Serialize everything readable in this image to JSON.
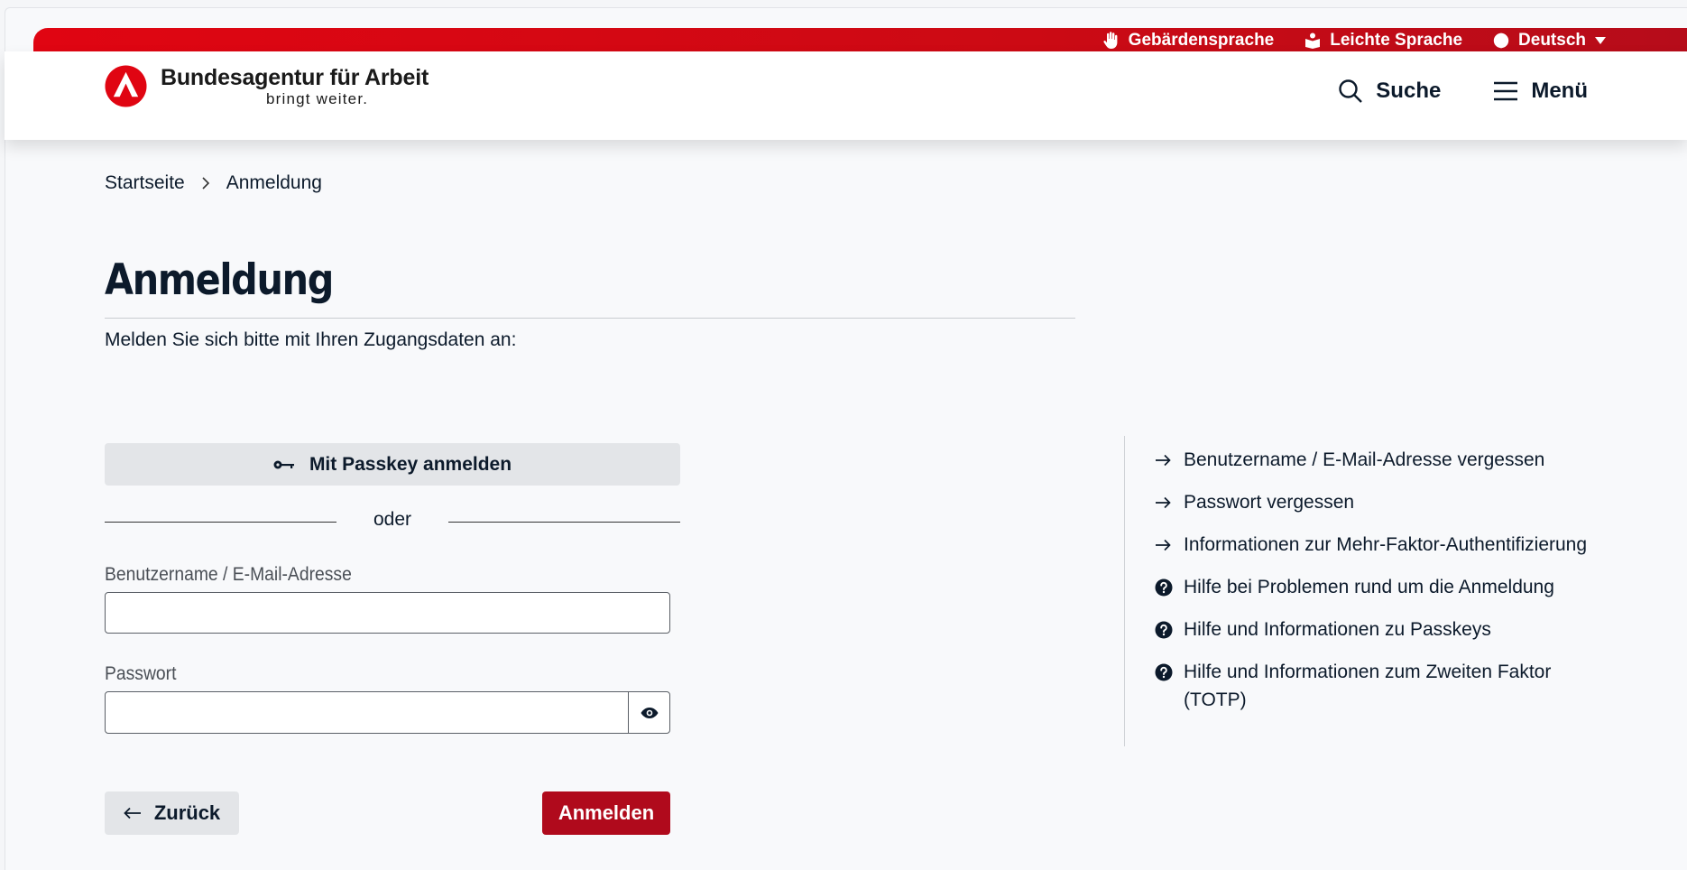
{
  "topbar": {
    "sign_language": "Gebärdensprache",
    "easy_language": "Leichte Sprache",
    "language": "Deutsch"
  },
  "header": {
    "logo_name": "Bundesagentur für Arbeit",
    "logo_claim": "bringt weiter.",
    "search_label": "Suche",
    "menu_label": "Menü"
  },
  "breadcrumb": {
    "home": "Startseite",
    "current": "Anmeldung"
  },
  "main": {
    "title": "Anmeldung",
    "intro": "Melden Sie sich bitte mit Ihren Zugangsdaten an:",
    "passkey_label": "Mit Passkey anmelden",
    "or_label": "oder",
    "username_label": "Benutzername / E-Mail-Adresse",
    "username_value": "",
    "password_label": "Passwort",
    "password_value": "",
    "back_label": "Zurück",
    "login_label": "Anmelden"
  },
  "links": [
    {
      "icon": "arrow-right-icon",
      "label": "Benutzername / E-Mail-Adresse vergessen"
    },
    {
      "icon": "arrow-right-icon",
      "label": "Passwort vergessen"
    },
    {
      "icon": "arrow-right-icon",
      "label": "Informationen zur Mehr-Faktor-Authentifizierung"
    },
    {
      "icon": "help-circle-icon",
      "label": "Hilfe bei Problemen rund um die Anmeldung"
    },
    {
      "icon": "help-circle-icon",
      "label": "Hilfe und Informationen zu Passkeys"
    },
    {
      "icon": "help-circle-icon",
      "label": "Hilfe und Informationen zum Zweiten Faktor (TOTP)"
    }
  ],
  "colors": {
    "brand_red": "#e00512",
    "primary_button": "#b00a1c",
    "text_dark": "#0c1a2b",
    "secondary_button": "#e3e5e8"
  }
}
